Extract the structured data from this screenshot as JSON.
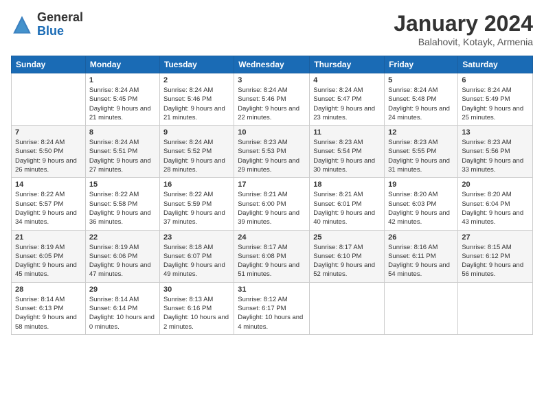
{
  "header": {
    "logo_general": "General",
    "logo_blue": "Blue",
    "month_title": "January 2024",
    "location": "Balahovit, Kotayk, Armenia"
  },
  "weekdays": [
    "Sunday",
    "Monday",
    "Tuesday",
    "Wednesday",
    "Thursday",
    "Friday",
    "Saturday"
  ],
  "weeks": [
    [
      {
        "day": "",
        "sunrise": "",
        "sunset": "",
        "daylight": ""
      },
      {
        "day": "1",
        "sunrise": "Sunrise: 8:24 AM",
        "sunset": "Sunset: 5:45 PM",
        "daylight": "Daylight: 9 hours and 21 minutes."
      },
      {
        "day": "2",
        "sunrise": "Sunrise: 8:24 AM",
        "sunset": "Sunset: 5:46 PM",
        "daylight": "Daylight: 9 hours and 21 minutes."
      },
      {
        "day": "3",
        "sunrise": "Sunrise: 8:24 AM",
        "sunset": "Sunset: 5:46 PM",
        "daylight": "Daylight: 9 hours and 22 minutes."
      },
      {
        "day": "4",
        "sunrise": "Sunrise: 8:24 AM",
        "sunset": "Sunset: 5:47 PM",
        "daylight": "Daylight: 9 hours and 23 minutes."
      },
      {
        "day": "5",
        "sunrise": "Sunrise: 8:24 AM",
        "sunset": "Sunset: 5:48 PM",
        "daylight": "Daylight: 9 hours and 24 minutes."
      },
      {
        "day": "6",
        "sunrise": "Sunrise: 8:24 AM",
        "sunset": "Sunset: 5:49 PM",
        "daylight": "Daylight: 9 hours and 25 minutes."
      }
    ],
    [
      {
        "day": "7",
        "sunrise": "Sunrise: 8:24 AM",
        "sunset": "Sunset: 5:50 PM",
        "daylight": "Daylight: 9 hours and 26 minutes."
      },
      {
        "day": "8",
        "sunrise": "Sunrise: 8:24 AM",
        "sunset": "Sunset: 5:51 PM",
        "daylight": "Daylight: 9 hours and 27 minutes."
      },
      {
        "day": "9",
        "sunrise": "Sunrise: 8:24 AM",
        "sunset": "Sunset: 5:52 PM",
        "daylight": "Daylight: 9 hours and 28 minutes."
      },
      {
        "day": "10",
        "sunrise": "Sunrise: 8:23 AM",
        "sunset": "Sunset: 5:53 PM",
        "daylight": "Daylight: 9 hours and 29 minutes."
      },
      {
        "day": "11",
        "sunrise": "Sunrise: 8:23 AM",
        "sunset": "Sunset: 5:54 PM",
        "daylight": "Daylight: 9 hours and 30 minutes."
      },
      {
        "day": "12",
        "sunrise": "Sunrise: 8:23 AM",
        "sunset": "Sunset: 5:55 PM",
        "daylight": "Daylight: 9 hours and 31 minutes."
      },
      {
        "day": "13",
        "sunrise": "Sunrise: 8:23 AM",
        "sunset": "Sunset: 5:56 PM",
        "daylight": "Daylight: 9 hours and 33 minutes."
      }
    ],
    [
      {
        "day": "14",
        "sunrise": "Sunrise: 8:22 AM",
        "sunset": "Sunset: 5:57 PM",
        "daylight": "Daylight: 9 hours and 34 minutes."
      },
      {
        "day": "15",
        "sunrise": "Sunrise: 8:22 AM",
        "sunset": "Sunset: 5:58 PM",
        "daylight": "Daylight: 9 hours and 36 minutes."
      },
      {
        "day": "16",
        "sunrise": "Sunrise: 8:22 AM",
        "sunset": "Sunset: 5:59 PM",
        "daylight": "Daylight: 9 hours and 37 minutes."
      },
      {
        "day": "17",
        "sunrise": "Sunrise: 8:21 AM",
        "sunset": "Sunset: 6:00 PM",
        "daylight": "Daylight: 9 hours and 39 minutes."
      },
      {
        "day": "18",
        "sunrise": "Sunrise: 8:21 AM",
        "sunset": "Sunset: 6:01 PM",
        "daylight": "Daylight: 9 hours and 40 minutes."
      },
      {
        "day": "19",
        "sunrise": "Sunrise: 8:20 AM",
        "sunset": "Sunset: 6:03 PM",
        "daylight": "Daylight: 9 hours and 42 minutes."
      },
      {
        "day": "20",
        "sunrise": "Sunrise: 8:20 AM",
        "sunset": "Sunset: 6:04 PM",
        "daylight": "Daylight: 9 hours and 43 minutes."
      }
    ],
    [
      {
        "day": "21",
        "sunrise": "Sunrise: 8:19 AM",
        "sunset": "Sunset: 6:05 PM",
        "daylight": "Daylight: 9 hours and 45 minutes."
      },
      {
        "day": "22",
        "sunrise": "Sunrise: 8:19 AM",
        "sunset": "Sunset: 6:06 PM",
        "daylight": "Daylight: 9 hours and 47 minutes."
      },
      {
        "day": "23",
        "sunrise": "Sunrise: 8:18 AM",
        "sunset": "Sunset: 6:07 PM",
        "daylight": "Daylight: 9 hours and 49 minutes."
      },
      {
        "day": "24",
        "sunrise": "Sunrise: 8:17 AM",
        "sunset": "Sunset: 6:08 PM",
        "daylight": "Daylight: 9 hours and 51 minutes."
      },
      {
        "day": "25",
        "sunrise": "Sunrise: 8:17 AM",
        "sunset": "Sunset: 6:10 PM",
        "daylight": "Daylight: 9 hours and 52 minutes."
      },
      {
        "day": "26",
        "sunrise": "Sunrise: 8:16 AM",
        "sunset": "Sunset: 6:11 PM",
        "daylight": "Daylight: 9 hours and 54 minutes."
      },
      {
        "day": "27",
        "sunrise": "Sunrise: 8:15 AM",
        "sunset": "Sunset: 6:12 PM",
        "daylight": "Daylight: 9 hours and 56 minutes."
      }
    ],
    [
      {
        "day": "28",
        "sunrise": "Sunrise: 8:14 AM",
        "sunset": "Sunset: 6:13 PM",
        "daylight": "Daylight: 9 hours and 58 minutes."
      },
      {
        "day": "29",
        "sunrise": "Sunrise: 8:14 AM",
        "sunset": "Sunset: 6:14 PM",
        "daylight": "Daylight: 10 hours and 0 minutes."
      },
      {
        "day": "30",
        "sunrise": "Sunrise: 8:13 AM",
        "sunset": "Sunset: 6:16 PM",
        "daylight": "Daylight: 10 hours and 2 minutes."
      },
      {
        "day": "31",
        "sunrise": "Sunrise: 8:12 AM",
        "sunset": "Sunset: 6:17 PM",
        "daylight": "Daylight: 10 hours and 4 minutes."
      },
      {
        "day": "",
        "sunrise": "",
        "sunset": "",
        "daylight": ""
      },
      {
        "day": "",
        "sunrise": "",
        "sunset": "",
        "daylight": ""
      },
      {
        "day": "",
        "sunrise": "",
        "sunset": "",
        "daylight": ""
      }
    ]
  ]
}
